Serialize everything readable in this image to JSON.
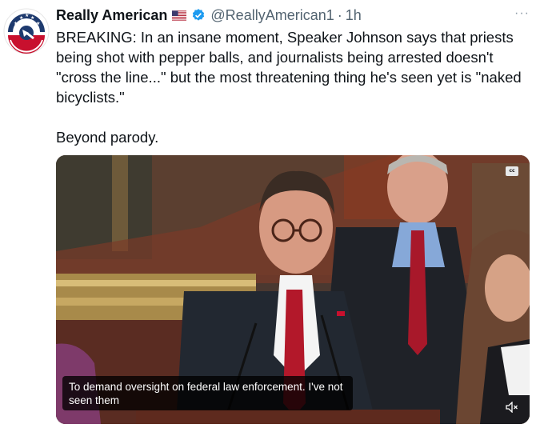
{
  "author": {
    "display_name": "Really American",
    "flag_icon": "us-flag-icon",
    "verified_icon": "verified-badge-icon",
    "handle": "@ReallyAmerican1",
    "separator": "·",
    "time": "1h"
  },
  "more_label": "···",
  "tweet": {
    "text": "BREAKING: In an insane moment, Speaker Johnson says that priests\nbeing shot with pepper balls, and journalists being arrested doesn't\n\"cross the line...\" but the most threatening thing he's seen yet is \"naked\nbicyclists.\"\n\nBeyond parody."
  },
  "media": {
    "cc_label": "cc",
    "caption": "To demand oversight on federal law enforcement. I've not seen them",
    "mute_icon": "speaker-muted-icon"
  },
  "colors": {
    "text_primary": "#0f1419",
    "text_secondary": "#536471",
    "verified_blue": "#1d9bf0",
    "brand_red": "#c8102e",
    "brand_blue": "#1e3a6e"
  }
}
